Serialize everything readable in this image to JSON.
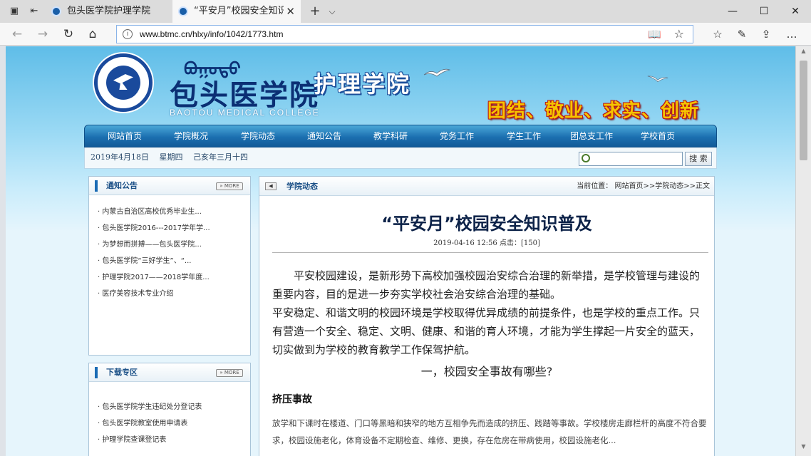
{
  "browser": {
    "tabs": [
      {
        "title": "包头医学院护理学院",
        "active": false
      },
      {
        "title": "“平安月”校园安全知识普",
        "active": true
      }
    ],
    "url": "www.btmc.cn/hlxy/info/1042/1773.htm",
    "icons": [
      "tab-aside-icon",
      "back-icon",
      "forward-icon",
      "refresh-icon",
      "home-icon",
      "reading-view-icon",
      "favorite-star-icon",
      "favorites-hub-icon",
      "pen-icon",
      "share-icon",
      "more-icon"
    ]
  },
  "site": {
    "mongolian": "ᠪᠣᠭᠣᠲᠣ",
    "college_cn": "包头医学院",
    "college_en": "BAOTOU MEDICAL COLLEGE",
    "department": "护理学院",
    "slogan": "团结、敬业、求实、创新"
  },
  "nav": [
    "网站首页",
    "学院概况",
    "学院动态",
    "通知公告",
    "教学科研",
    "党务工作",
    "学生工作",
    "团总支工作",
    "学校首页"
  ],
  "datebar": {
    "text": "2019年4月18日　 星期四　 己亥年三月十四",
    "search_button": "搜 索"
  },
  "notice": {
    "title": "通知公告",
    "more": "» MORE",
    "items": [
      "内蒙古自治区高校优秀毕业生...",
      "包头医学院2016---2017学年学...",
      "为梦想而拼搏——包头医学院...",
      "包头医学院“三好学生”、“...",
      "护理学院2017——2018学年度...",
      "医疗美容技术专业介绍"
    ]
  },
  "download": {
    "title": "下载专区",
    "more": "» MORE",
    "items": [
      "包头医学院学生违纪处分登记表",
      "包头医学院教室使用申请表",
      "护理学院查课登记表"
    ]
  },
  "article": {
    "section": "学院动态",
    "location": "当前位置： 网站首页>>学院动态>>正文",
    "title": "“平安月”校园安全知识普及",
    "meta": "2019-04-16 12:56  点击：[150]",
    "p1": "平安校园建设，是新形势下高校加强校园治安综合治理的新举措，是学校管理与建设的重要内容，目的是进一步夯实学校社会治安综合治理的基础。",
    "p2": "平安稳定、和谐文明的校园环境是学校取得优异成绩的前提条件，也是学校的重点工作。只有营造一个安全、稳定、文明、健康、和谐的育人环境，才能为学生撑起一片安全的蓝天，切实做到为学校的教育教学工作保驾护航。",
    "sec1": "一，校园安全事故有哪些?",
    "sub1": "挤压事故",
    "body1": "放学和下课时在楼道、门口等黑暗和狭窄的地方互相争先而造成的挤压、践踏等事故。学校楼房走廊栏杆的高度不符合要求，校园设施老化，体育设备不定期检查、维修、更换，存在危房在带病使用，校园设施老化..."
  }
}
